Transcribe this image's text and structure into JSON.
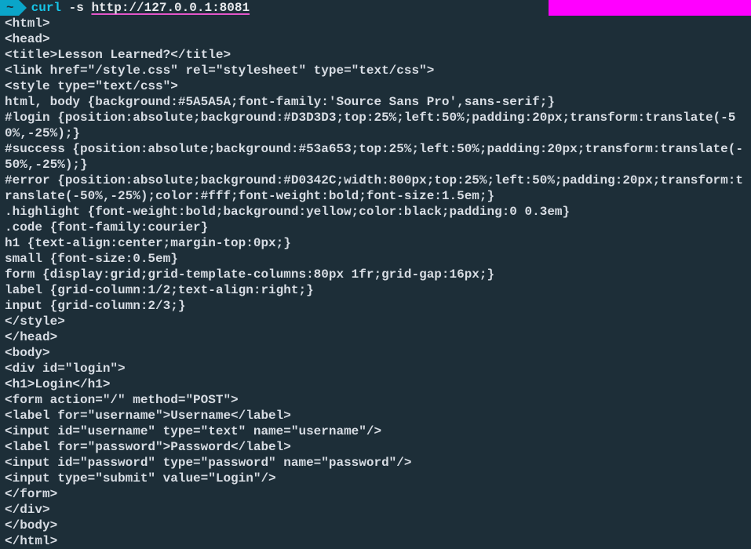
{
  "prompt": {
    "cwd_badge": "~",
    "command": "curl",
    "flag": "-s",
    "url": "http://127.0.0.1:8081"
  },
  "output_lines": [
    "<html>",
    "<head>",
    "<title>Lesson Learned?</title>",
    "<link href=\"/style.css\" rel=\"stylesheet\" type=\"text/css\">",
    "<style type=\"text/css\">",
    "html, body {background:#5A5A5A;font-family:'Source Sans Pro',sans-serif;}",
    "#login {position:absolute;background:#D3D3D3;top:25%;left:50%;padding:20px;transform:translate(-50%,-25%);}",
    "#success {position:absolute;background:#53a653;top:25%;left:50%;padding:20px;transform:translate(-50%,-25%);}",
    "#error {position:absolute;background:#D0342C;width:800px;top:25%;left:50%;padding:20px;transform:translate(-50%,-25%);color:#fff;font-weight:bold;font-size:1.5em;}",
    ".highlight {font-weight:bold;background:yellow;color:black;padding:0 0.3em}",
    ".code {font-family:courier}",
    "h1 {text-align:center;margin-top:0px;}",
    "small {font-size:0.5em}",
    "form {display:grid;grid-template-columns:80px 1fr;grid-gap:16px;}",
    "label {grid-column:1/2;text-align:right;}",
    "input {grid-column:2/3;}",
    "</style>",
    "</head>",
    "<body>",
    "<div id=\"login\">",
    "<h1>Login</h1>",
    "<form action=\"/\" method=\"POST\">",
    "<label for=\"username\">Username</label>",
    "<input id=\"username\" type=\"text\" name=\"username\"/>",
    "<label for=\"password\">Password</label>",
    "<input id=\"password\" type=\"password\" name=\"password\"/>",
    "<input type=\"submit\" value=\"Login\"/>",
    "</form>",
    "</div>",
    "</body>",
    "</html>"
  ]
}
